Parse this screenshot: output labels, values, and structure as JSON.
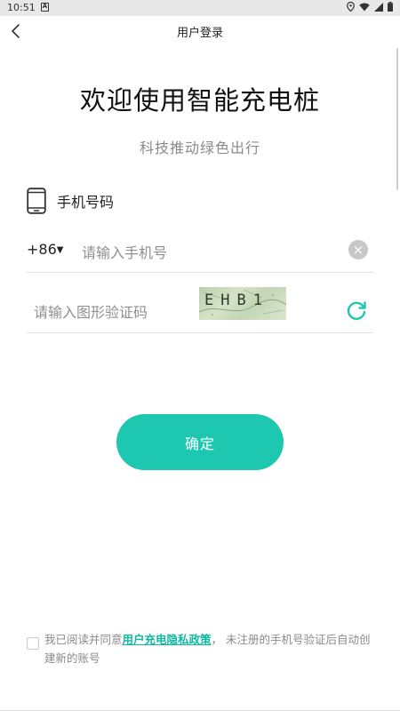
{
  "status_bar": {
    "time": "10:51",
    "notification_glyph": "A"
  },
  "app_bar": {
    "title": "用户登录"
  },
  "headline": "欢迎使用智能充电桩",
  "subheadline": "科技推动绿色出行",
  "phone_section": {
    "label": "手机号码",
    "country_code": "+86",
    "country_code_arrow": "▼",
    "phone_placeholder": "请输入手机号",
    "clear_glyph": "×"
  },
  "captcha_section": {
    "placeholder": "请输入图形验证码",
    "captcha_text": "EHB1"
  },
  "confirm_button": {
    "label": "确定"
  },
  "agreement": {
    "prefix": "我已阅读并同意",
    "link_text": "用户充电隐私政策",
    "suffix": "， 未注册的手机号验证后自动创建新的账号"
  },
  "colors": {
    "accent": "#1ec8b0",
    "link": "#12b7a0",
    "placeholder": "#8f8f8f",
    "divider": "#e2e2e2"
  },
  "icons": {
    "back": "chevron-left-icon",
    "phone": "mobile-phone-icon",
    "clear": "clear-circle-icon",
    "refresh": "refresh-icon",
    "location": "location-icon",
    "wifi": "wifi-icon",
    "signal": "signal-icon",
    "battery": "battery-icon"
  }
}
